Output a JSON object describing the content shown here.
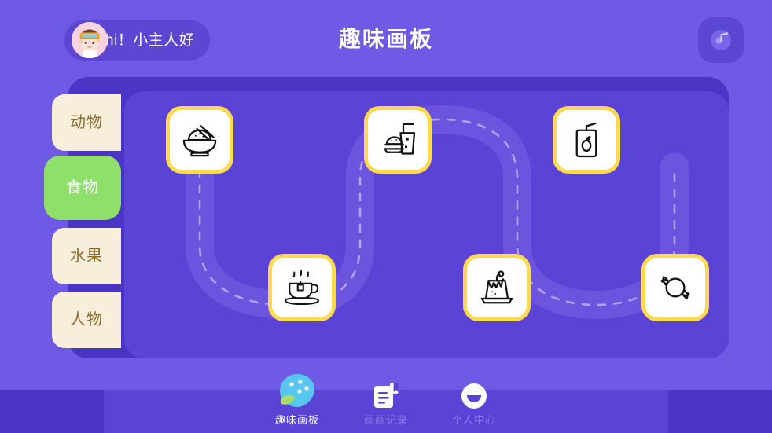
{
  "header": {
    "greeting": "hi！小主人好",
    "title": "趣味画板",
    "avatar_name": "child-avatar",
    "music_button_label": "music-toggle"
  },
  "sidebar": {
    "items": [
      {
        "label": "动物",
        "active": false
      },
      {
        "label": "食物",
        "active": true
      },
      {
        "label": "水果",
        "active": false
      },
      {
        "label": "人物",
        "active": false
      }
    ]
  },
  "board": {
    "cards": [
      {
        "icon": "rice-bowl-icon",
        "label": "米饭"
      },
      {
        "icon": "burger-drink-icon",
        "label": "汉堡饮料"
      },
      {
        "icon": "juice-box-icon",
        "label": "果汁"
      },
      {
        "icon": "teacup-icon",
        "label": "茶杯"
      },
      {
        "icon": "pudding-icon",
        "label": "布丁"
      },
      {
        "icon": "candy-icon",
        "label": "糖果"
      }
    ]
  },
  "bottom_nav": {
    "items": [
      {
        "label": "趣味画板",
        "icon": "palette-icon",
        "active": true
      },
      {
        "label": "画画记录",
        "icon": "document-icon",
        "active": false
      },
      {
        "label": "个人中心",
        "icon": "profile-smiley-icon",
        "active": false
      }
    ]
  },
  "colors": {
    "background": "#6f5ae6",
    "board_outer": "#4b35c4",
    "board_inner": "#5b43d6",
    "pill": "#5c47d2",
    "tab_idle": "#f7eedc",
    "tab_active": "#8ee06a",
    "card_border": "#ffd94f",
    "nav_inactive_text": "#8b79e8",
    "palette_blue": "#57c7ef",
    "palette_green": "#a8dd6c"
  }
}
